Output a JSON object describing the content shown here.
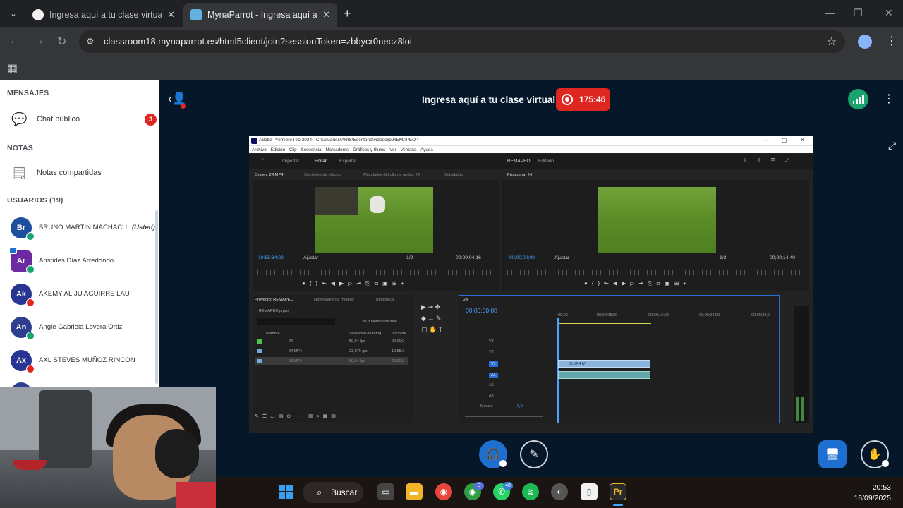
{
  "browser": {
    "tabs": [
      {
        "title": "Ingresa aquí a tu clase virtual",
        "favicon_color": "#f2f2f2"
      },
      {
        "title": "MynaParrot - Ingresa aquí a tu c",
        "favicon_color": "#62b1e0"
      }
    ],
    "url": "classroom18.mynaparrot.es/html5client/join?sessionToken=zbbycr0necz8loi",
    "icons": [
      "tab-search-icon",
      "close-icon",
      "new-tab-icon",
      "back-icon",
      "forward-icon",
      "reload-icon",
      "site-info-icon",
      "bookmark-star-icon",
      "profile-icon",
      "menu-icon",
      "apps-grid-icon"
    ]
  },
  "sidebar": {
    "messages_header": "MENSAJES",
    "public_chat": {
      "label": "Chat público",
      "unread": "3"
    },
    "notes_header": "NOTAS",
    "shared_notes": "Notas compartidas",
    "users_header": "USUARIOS (19)",
    "users": [
      {
        "initials": "Br",
        "name": "BRUNO MARTIN MACHACU...",
        "you": "(Usted)",
        "color": "#1d4f9c",
        "status": "#1aa36f",
        "shape": "circle"
      },
      {
        "initials": "Ar",
        "name": "Aristides Díaz Arredondo",
        "color": "#6b2aa1",
        "status": "#1aa36f",
        "shape": "square"
      },
      {
        "initials": "Ak",
        "name": "AKEMY ALIJU AGUIRRE LAU",
        "color": "#283593",
        "status": "#df2721",
        "shape": "circle"
      },
      {
        "initials": "An",
        "name": "Angie Gabriela Lovera Ortiz",
        "color": "#2f3f8f",
        "status": "#1aa36f",
        "shape": "circle"
      },
      {
        "initials": "Ax",
        "name": "AXL STEVES MUÑOZ RINCON",
        "color": "#283593",
        "status": "#df2721",
        "shape": "circle"
      }
    ]
  },
  "session": {
    "title": "Ingresa aquí a tu clase virtual",
    "recording_time": "175:46",
    "colors": {
      "recording": "#df2721",
      "connection": "#1aa36f",
      "background": "#06172a"
    }
  },
  "premiere": {
    "window_title": "Adobe Premiere Pro 2024 - C:\\Usuarios\\ARIS\\Escritorio\\videoclip\\REMAPEO *",
    "menu": [
      "Archivo",
      "Edición",
      "Clip",
      "Secuencia",
      "Marcadores",
      "Gráficos y títulos",
      "Ver",
      "Ventana",
      "Ayuda"
    ],
    "workspaces": [
      "Importar",
      "Editar",
      "Exportar"
    ],
    "project_name": "REMAPEO",
    "project_sub": "Editado",
    "source_tabs": [
      "Origen: 24.MP4",
      "Controles de efectos",
      "Mezclador del clip de audio: 24",
      "Metadatos"
    ],
    "program_tab": "Programa: 24",
    "source_tc_left": "10:55:34:09",
    "source_fit": "Ajustar",
    "source_res": "1/2",
    "source_tc_right": "00:00:04:16",
    "program_tc_left": "00;00;00;00",
    "program_fit": "Ajustar",
    "program_res": "1/2",
    "program_tc_right": "00;00;14;40",
    "project_tabs": [
      "Proyecto: REMAPEO",
      "Navegador de medios",
      "Biblioteca"
    ],
    "project_file": "REMAPEO.prproj",
    "project_count": "1 de 3 elementos sele...",
    "project_cols": [
      "Nombre",
      "Velocidad de fotog",
      "Inicio de"
    ],
    "project_items": [
      {
        "name": "24",
        "fps": "59,94 fps",
        "start": "00;00;0"
      },
      {
        "name": "24.MP4",
        "fps": "23,976 fps",
        "start": "10:55:2"
      },
      {
        "name": "03.MP4",
        "fps": "59,94 fps",
        "start": "00:00:0"
      }
    ],
    "timeline_name": "24",
    "timeline_tc": "00;00;00;00",
    "timeline_ruler": [
      "00;00",
      "00;00;08;00",
      "00;00;16;00",
      "00;00;24;00",
      "00;00;32;0"
    ],
    "tracks": [
      "V3",
      "V2",
      "V1",
      "A1",
      "A2",
      "A3",
      "Mezcla"
    ],
    "clip_label": "03.MP4 [V]",
    "mix_value": "0,0"
  },
  "controls": {
    "audio_color": "#1f6fd1",
    "share_color": "#1f6fd1"
  },
  "taskbar": {
    "search": "Buscar",
    "time": "20:53",
    "date": "16/09/2025",
    "whatsapp_badge": "48",
    "chrome_badge": "D"
  }
}
